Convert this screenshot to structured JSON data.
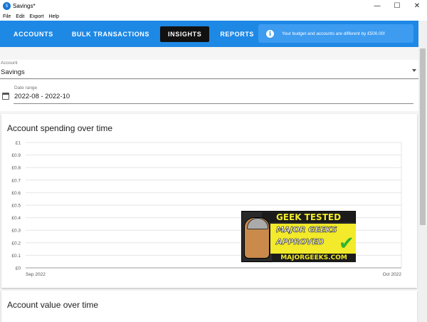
{
  "window": {
    "title": "Savings*",
    "app_icon_text": "S",
    "controls": {
      "minimize": "—",
      "maximize": "☐",
      "close": "✕"
    }
  },
  "menu": [
    "File",
    "Edit",
    "Export",
    "Help"
  ],
  "nav": {
    "tabs": [
      {
        "label": "ACCOUNTS",
        "active": false
      },
      {
        "label": "BULK TRANSACTIONS",
        "active": false
      },
      {
        "label": "INSIGHTS",
        "active": true
      },
      {
        "label": "REPORTS",
        "active": false
      }
    ],
    "alert_icon": "info-icon",
    "alert_text": "Your budget and accounts are different by £500.00!"
  },
  "account_field": {
    "label": "Account",
    "value": "Savings",
    "icon": "dropdown-arrow-icon"
  },
  "date_range": {
    "label": "Date range",
    "value": "2022-08 - 2022-10",
    "icon": "calendar-icon"
  },
  "spending_card": {
    "title": "Account spending over time"
  },
  "value_card": {
    "title": "Account value over time"
  },
  "badge": {
    "top": "GEEK TESTED",
    "line1": "MAJOR GEEKS",
    "line2": "APPROVED",
    "url": "MAJORGEEKS.COM"
  },
  "colors": {
    "appbar": "#1e88e5",
    "alert": "#3d9bf0",
    "active_tab": "#111111",
    "gridline": "#e6e6e6"
  },
  "chart_data": {
    "type": "line",
    "title": "Account spending over time",
    "x_tick_labels": [
      "Sep 2022",
      "Oct 2022"
    ],
    "y_tick_labels": [
      "£0",
      "£0.1",
      "£0.2",
      "£0.3",
      "£0.4",
      "£0.5",
      "£0.6",
      "£0.7",
      "£0.8",
      "£0.9",
      "£1"
    ],
    "ylim": [
      0,
      1
    ],
    "grid": true,
    "series": []
  }
}
